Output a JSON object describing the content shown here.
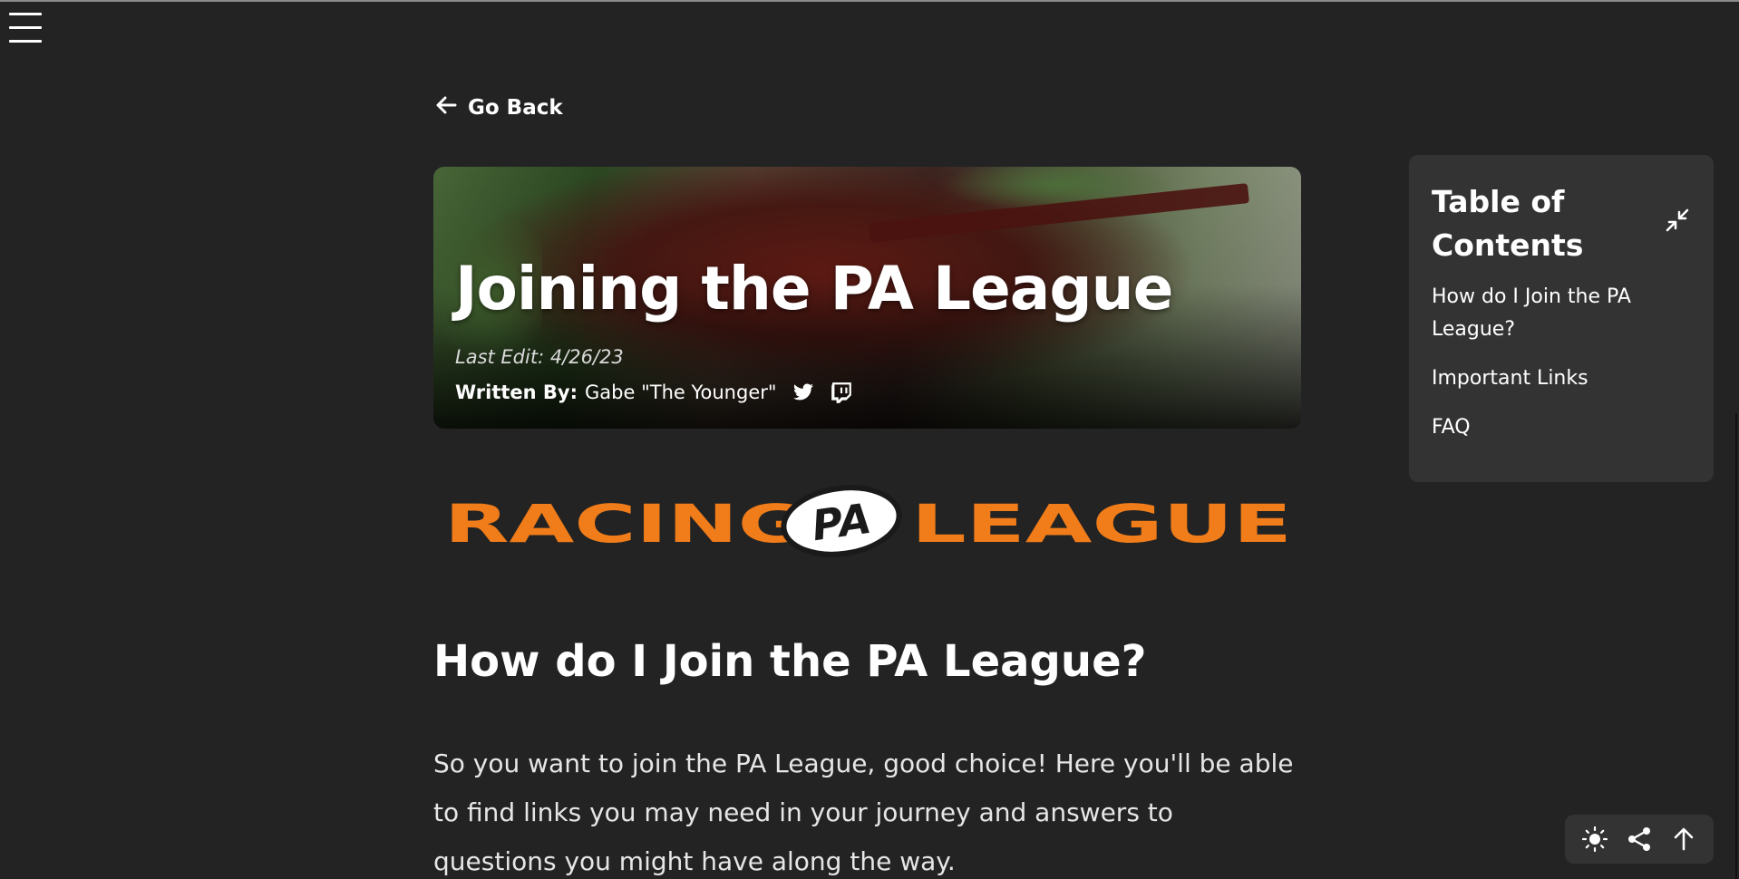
{
  "nav": {
    "menu_icon": "hamburger-menu-icon",
    "go_back_label": "Go Back",
    "go_back_icon": "arrow-left-icon"
  },
  "hero": {
    "title": "Joining the PA League",
    "last_edit": "Last Edit: 4/26/23",
    "written_by_label": "Written By:",
    "author": "Gabe \"The Younger\"",
    "social_icons": [
      "twitter-icon",
      "twitch-icon"
    ]
  },
  "logo": {
    "left_text": "RACING",
    "center_text": "PA",
    "right_text": "LEAGUE",
    "colors": {
      "orange": "#f07c1a",
      "badge_fill": "#ffffff",
      "badge_text": "#1a1a1a"
    }
  },
  "article": {
    "section_heading": "How do I Join the PA League?",
    "intro": "So you want to join the PA League, good choice! Here you'll be able to find links you may need in your journey and answers to questions you might have along the way."
  },
  "toc": {
    "title": "Table of Contents",
    "collapse_icon": "collapse-arrows-icon",
    "items": [
      {
        "label": "How do I Join the PA League?"
      },
      {
        "label": "Important Links"
      },
      {
        "label": "FAQ"
      }
    ]
  },
  "floating_actions": {
    "icons": [
      "sun-theme-icon",
      "share-icon",
      "arrow-up-icon"
    ]
  },
  "colors": {
    "background": "#232323",
    "panel": "#333333",
    "text": "#ffffff"
  }
}
